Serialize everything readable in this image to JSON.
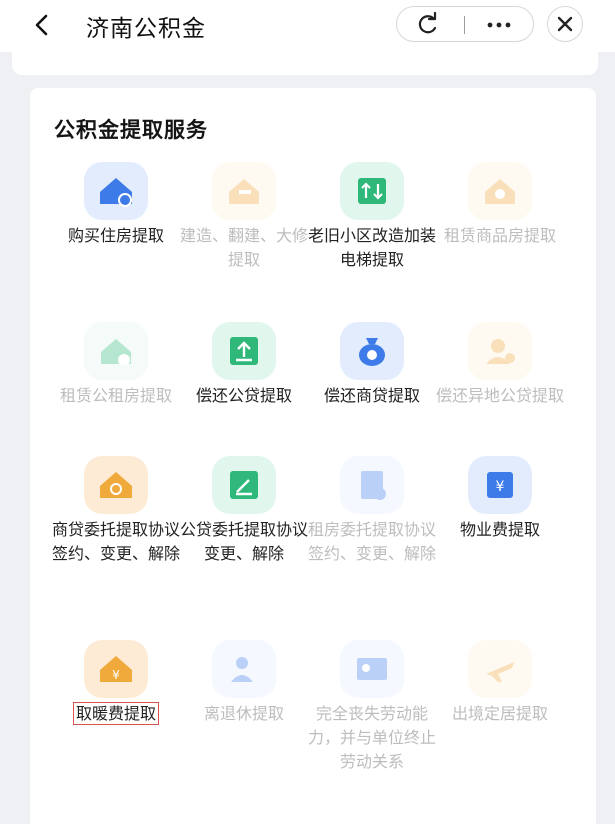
{
  "header": {
    "back_icon": "chevron-left-icon",
    "title": "济南公积金",
    "more_label": "···",
    "close_label": "✕"
  },
  "section": {
    "title": "公积金提取服务",
    "items": [
      {
        "label": "购买住房提取",
        "enabled": true,
        "icon": "house-coin-icon",
        "color": "#3d7be8"
      },
      {
        "label": "建造、翻建、大修提取",
        "enabled": false,
        "icon": "house-hammer-icon",
        "color": "#f0a93b"
      },
      {
        "label": "老旧小区改造加装电梯提取",
        "enabled": true,
        "icon": "elevator-icon",
        "color": "#2fb87a"
      },
      {
        "label": "租赁商品房提取",
        "enabled": false,
        "icon": "rent-house-icon",
        "color": "#f0a93b"
      },
      {
        "label": "租赁公租房提取",
        "enabled": false,
        "icon": "public-housing-icon",
        "color": "#2fb87a"
      },
      {
        "label": "偿还公贷提取",
        "enabled": true,
        "icon": "upload-repay-icon",
        "color": "#2fb87a"
      },
      {
        "label": "偿还商贷提取",
        "enabled": true,
        "icon": "money-bag-icon",
        "color": "#3d7be8"
      },
      {
        "label": "偿还异地公贷提取",
        "enabled": false,
        "icon": "person-coin-icon",
        "color": "#f0a93b"
      },
      {
        "label": "商贷委托提取协议签约、变更、解除",
        "enabled": true,
        "icon": "house-cycle-icon",
        "color": "#f0a93b"
      },
      {
        "label": "公贷委托提取协议变更、解除",
        "enabled": true,
        "icon": "edit-doc-icon",
        "color": "#2fb87a"
      },
      {
        "label": "租房委托提取协议签约、变更、解除",
        "enabled": false,
        "icon": "rent-doc-icon",
        "color": "#3d7be8"
      },
      {
        "label": "物业费提取",
        "enabled": true,
        "icon": "property-fee-icon",
        "color": "#3d7be8"
      },
      {
        "label": "取暖费提取",
        "enabled": true,
        "icon": "heating-fee-icon",
        "color": "#f0a93b",
        "highlighted": true
      },
      {
        "label": "离退休提取",
        "enabled": false,
        "icon": "retire-icon",
        "color": "#3d7be8"
      },
      {
        "label": "完全丧失劳动能力，并与单位终止劳动关系",
        "enabled": false,
        "icon": "id-card-icon",
        "color": "#3d7be8"
      },
      {
        "label": "出境定居提取",
        "enabled": false,
        "icon": "airplane-icon",
        "color": "#f0a93b"
      }
    ]
  }
}
